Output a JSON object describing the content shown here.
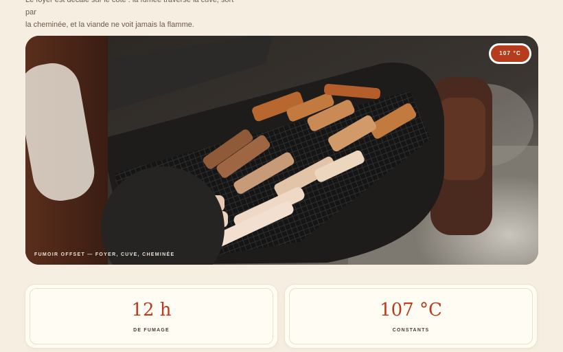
{
  "intro": {
    "line1": "Le foyer est décalé sur le côté : la fumée traverse la cuve, sort par",
    "line2": "la cheminée, et la viande ne voit jamais la flamme."
  },
  "hero": {
    "image": "offset-smoker-photo",
    "badge": "107 °C",
    "caption": "FUMOIR OFFSET — FOYER, CUVE, CHEMINÉE"
  },
  "stats": [
    {
      "value": "12 h",
      "label": "DE FUMAGE"
    },
    {
      "value": "107 °C",
      "label": "CONSTANTS"
    }
  ],
  "colors": {
    "accent": "#b53d1e",
    "background": "#f6efe1",
    "card": "#fffcf4"
  }
}
